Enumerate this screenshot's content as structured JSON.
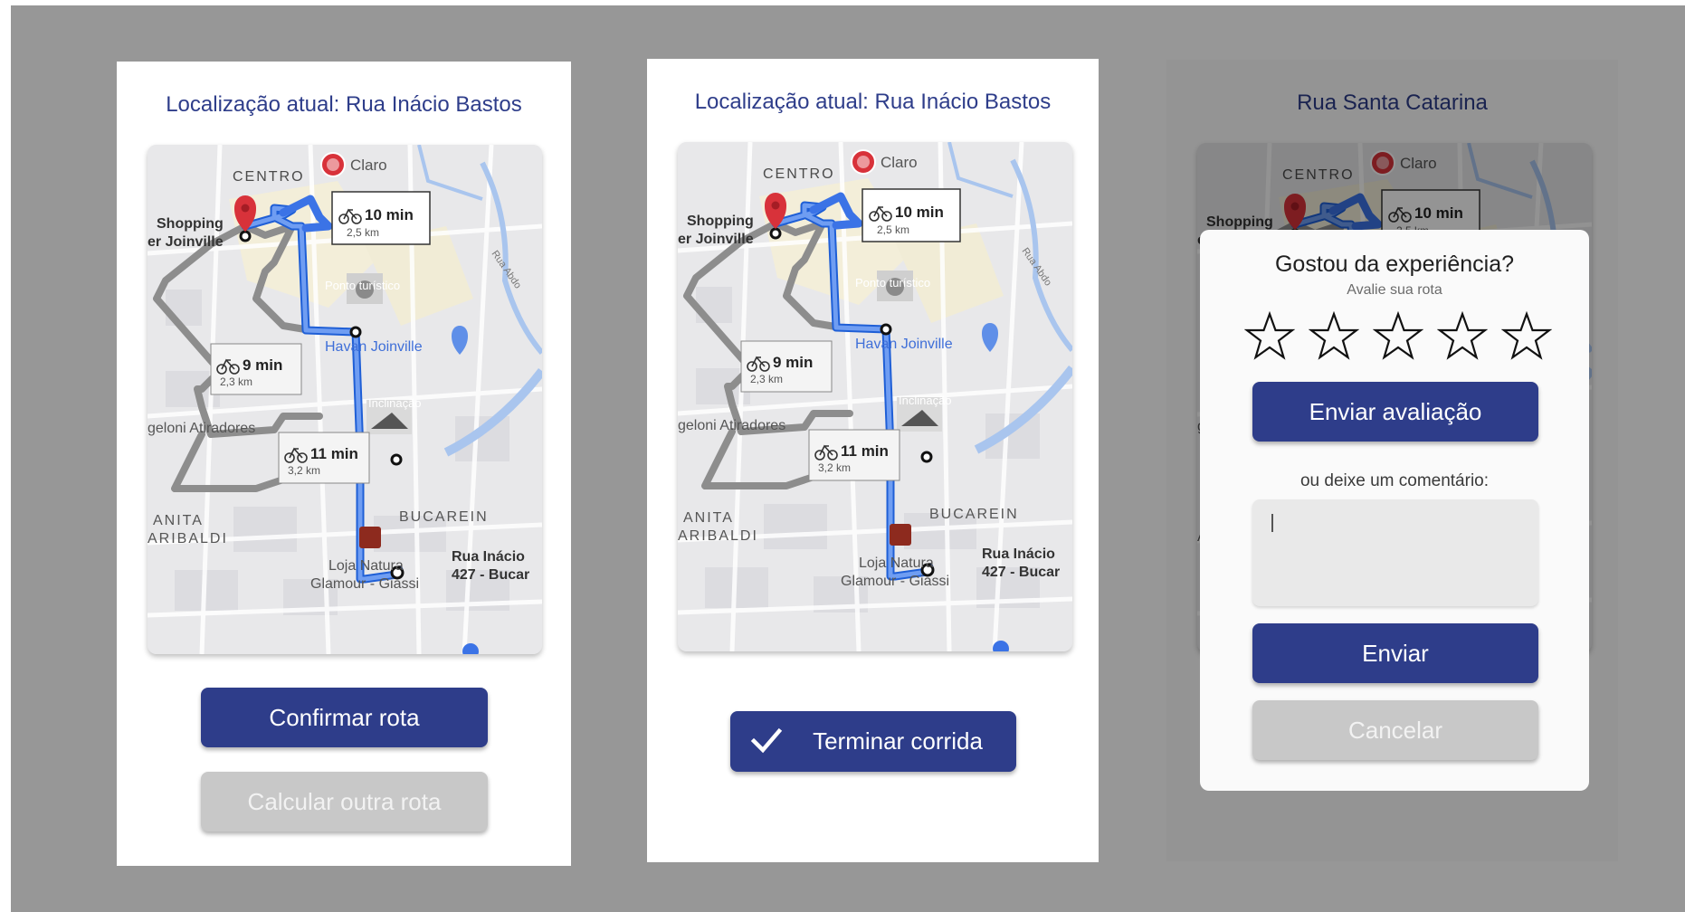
{
  "panels": {
    "p1": {
      "title": "Localização atual: Rua Inácio Bastos",
      "confirm_label": "Confirmar rota",
      "other_route_label": "Calcular outra rota"
    },
    "p2": {
      "title": "Localização atual: Rua Inácio Bastos",
      "finish_label": "Terminar corrida"
    },
    "p3": {
      "title": "Rua Santa Catarina",
      "modal": {
        "title": "Gostou da experiência?",
        "subtitle": "Avalie sua rota",
        "stars_total": 5,
        "stars_selected": 0,
        "send_rating_label": "Enviar avaliação",
        "or_comment": "ou deixe um comentário:",
        "comment_value": "",
        "send_label": "Enviar",
        "cancel_label": "Cancelar"
      }
    }
  },
  "map": {
    "labels": {
      "centro": "CENTRO",
      "claro": "Claro",
      "shopping1": "Shopping",
      "shopping2": "er Joinville",
      "ponto": "Ponto turístico",
      "havan": "Havan Joinville",
      "inclinacao": "Inclinação",
      "angeloni": "geloni Atiradores",
      "anita1": "ANITA",
      "anita2": "ARIBALDI",
      "bucarein": "BUCAREIN",
      "loja1": "Loja Natura",
      "loja2": "Glamour - Giassi",
      "dest1": "Rua Inácio",
      "dest2": "427 - Bucar",
      "rua_abdon": "Rua Abdo"
    },
    "routes": [
      {
        "time": "10 min",
        "dist": "2,5 km"
      },
      {
        "time": "9 min",
        "dist": "2,3 km"
      },
      {
        "time": "11 min",
        "dist": "3,2 km"
      }
    ],
    "colors": {
      "route_main": "#3b73e6",
      "route_alt": "#8d8d8d",
      "pin": "#d8323a",
      "primary": "#2e3d8a",
      "disabled": "#c8c8c8"
    }
  }
}
